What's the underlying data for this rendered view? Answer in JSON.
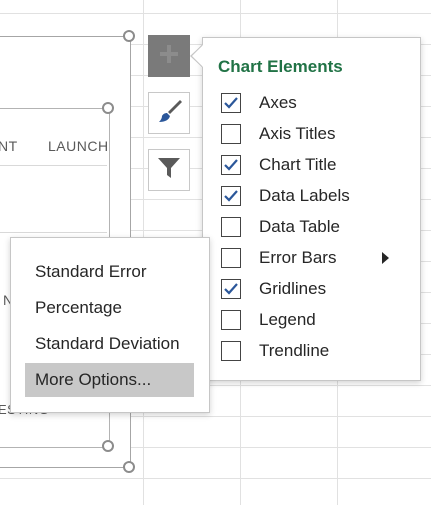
{
  "chart": {
    "axis_labels": [
      "NT",
      "LAUNCH",
      "N",
      "ESTING"
    ]
  },
  "tools": [
    {
      "name": "chart-elements-button",
      "icon": "plus-icon",
      "active": true
    },
    {
      "name": "chart-styles-button",
      "icon": "paintbrush-icon",
      "active": false
    },
    {
      "name": "chart-filters-button",
      "icon": "funnel-icon",
      "active": false
    }
  ],
  "chart_elements": {
    "title": "Chart Elements",
    "items": [
      {
        "label": "Axes",
        "checked": true
      },
      {
        "label": "Axis Titles",
        "checked": false
      },
      {
        "label": "Chart Title",
        "checked": true
      },
      {
        "label": "Data Labels",
        "checked": true
      },
      {
        "label": "Data Table",
        "checked": false
      },
      {
        "label": "Error Bars",
        "checked": false,
        "has_submenu": true
      },
      {
        "label": "Gridlines",
        "checked": true
      },
      {
        "label": "Legend",
        "checked": false
      },
      {
        "label": "Trendline",
        "checked": false
      }
    ]
  },
  "error_bars_menu": {
    "items": [
      {
        "label": "Standard Error"
      },
      {
        "label": "Percentage"
      },
      {
        "label": "Standard Deviation"
      },
      {
        "label": "More Options...",
        "highlighted": true
      }
    ]
  },
  "colors": {
    "accent_green": "#217346",
    "checkmark_blue": "#2b579a",
    "active_button": "#7a7a7a"
  }
}
